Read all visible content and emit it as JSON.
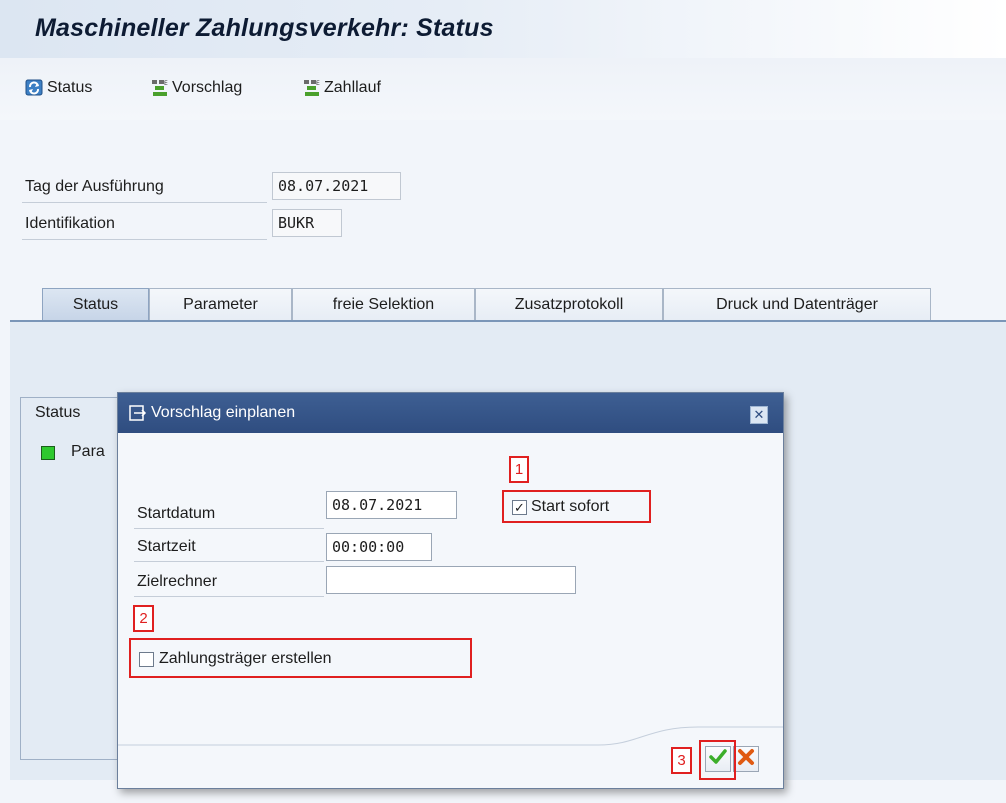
{
  "title": "Maschineller Zahlungsverkehr: Status",
  "toolbar": {
    "items": [
      {
        "label": "Status",
        "icon": "refresh-status-icon"
      },
      {
        "label": "Vorschlag",
        "icon": "proposal-icon"
      },
      {
        "label": "Zahllauf",
        "icon": "payment-run-icon"
      }
    ]
  },
  "fields": {
    "execution_date_label": "Tag der Ausführung",
    "execution_date_value": "08.07.2021",
    "identification_label": "Identifikation",
    "identification_value": "BUKR"
  },
  "tabs": [
    {
      "label": "Status",
      "active": true
    },
    {
      "label": "Parameter",
      "active": false
    },
    {
      "label": "freie Selektion",
      "active": false
    },
    {
      "label": "Zusatzprotokoll",
      "active": false
    },
    {
      "label": "Druck und Datenträger",
      "active": false
    }
  ],
  "status_group": {
    "title": "Status",
    "row_text": "Para",
    "led_color": "#2ec92e"
  },
  "dialog": {
    "title": "Vorschlag einplanen",
    "startdatum_label": "Startdatum",
    "startdatum_value": "08.07.2021",
    "startzeit_label": "Startzeit",
    "startzeit_value": "00:00:00",
    "zielrechner_label": "Zielrechner",
    "zielrechner_value": "",
    "start_sofort_label": "Start sofort",
    "start_sofort_checked": true,
    "zahlungstraeger_label": "Zahlungsträger erstellen",
    "zahlungstraeger_checked": false
  },
  "annotations": {
    "marker_1": "1",
    "marker_2": "2",
    "marker_3": "3",
    "color": "#e02020"
  },
  "colors": {
    "title_bar": "#dce6f2",
    "dialog_header": "#2f4d80",
    "confirm_green": "#3cae2a",
    "cancel_red": "#e05a12"
  }
}
